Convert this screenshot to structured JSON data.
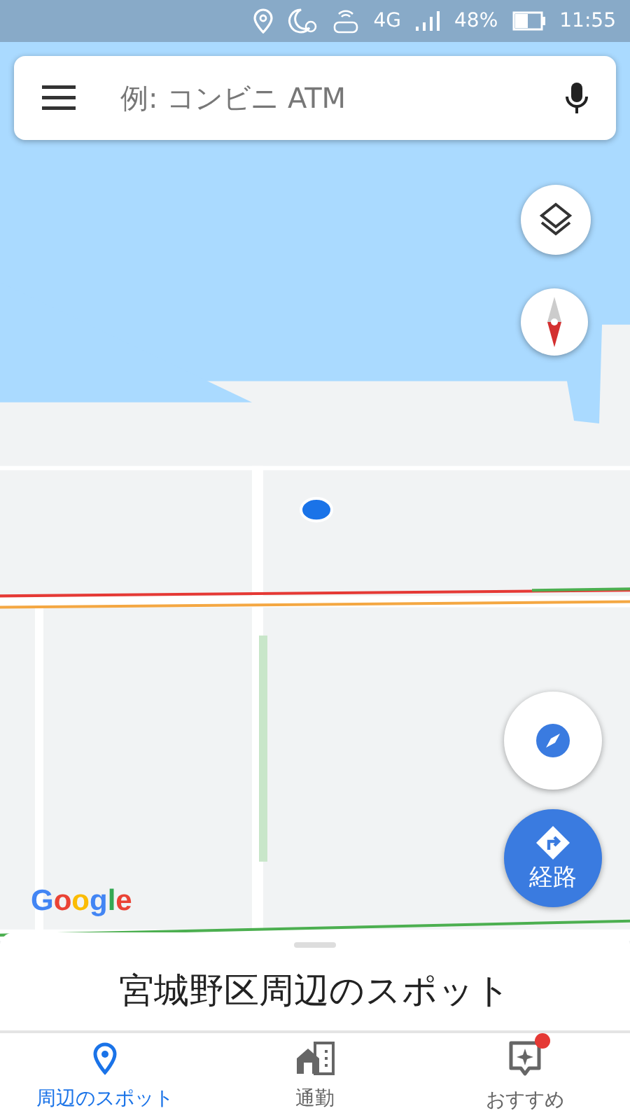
{
  "status_bar": {
    "network": "4G",
    "battery": "48%",
    "time": "11:55"
  },
  "search": {
    "placeholder": "例: コンビニ ATM"
  },
  "map": {
    "logo": "Google",
    "directions_button": "経路"
  },
  "sheet": {
    "title": "宮城野区周辺のスポット"
  },
  "bottom_nav": [
    {
      "kind": "explore",
      "label": "周辺のスポット",
      "selected": true,
      "notification": false
    },
    {
      "kind": "commute",
      "label": "通勤",
      "selected": false,
      "notification": false
    },
    {
      "kind": "foryou",
      "label": "おすすめ",
      "selected": false,
      "notification": true
    }
  ]
}
